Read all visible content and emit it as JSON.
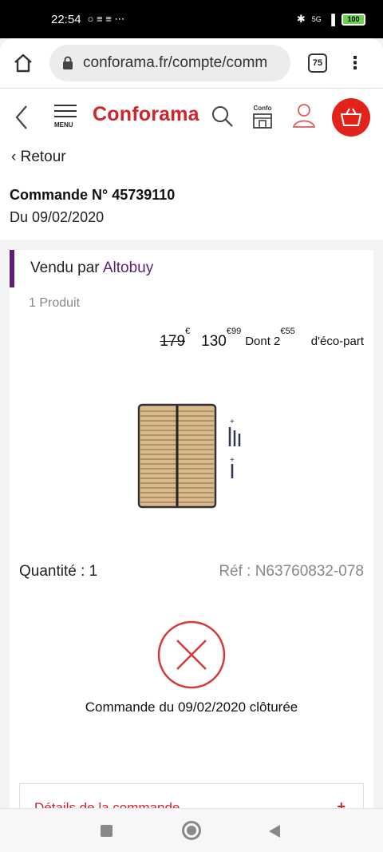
{
  "status": {
    "time": "22:54",
    "left_icons": "○ ≡ ≡ ⋯",
    "network": "5G",
    "battery": "100"
  },
  "browser": {
    "url": "conforama.fr/compte/comm",
    "tab_count": "75"
  },
  "header": {
    "menu_label": "MENU",
    "logo": "Conforama",
    "confo_label": "Confo"
  },
  "page": {
    "back_label": "Retour",
    "order_title": "Commande N° 45739110",
    "order_date": "Du 09/02/2020"
  },
  "card": {
    "sold_by_label": "Vendu par",
    "seller": "Altobuy",
    "product_count": "1 Produit",
    "old_price": "179",
    "old_price_cur": "€",
    "new_price": "130",
    "new_price_cents": "€99",
    "eco_prefix": "Dont 2",
    "eco_cents": "€55",
    "eco_suffix": "d'éco-part",
    "quantity": "Quantité : 1",
    "reference": "Réf : N63760832-078",
    "status_text": "Commande du 09/02/2020 clôturée",
    "details_label": "Détails de la commande",
    "details_toggle": "+"
  },
  "colors": {
    "brand_red": "#d3232b",
    "cart_red": "#e2231a",
    "seller_purple": "#5b1f78",
    "status_red": "#d33a3a"
  }
}
